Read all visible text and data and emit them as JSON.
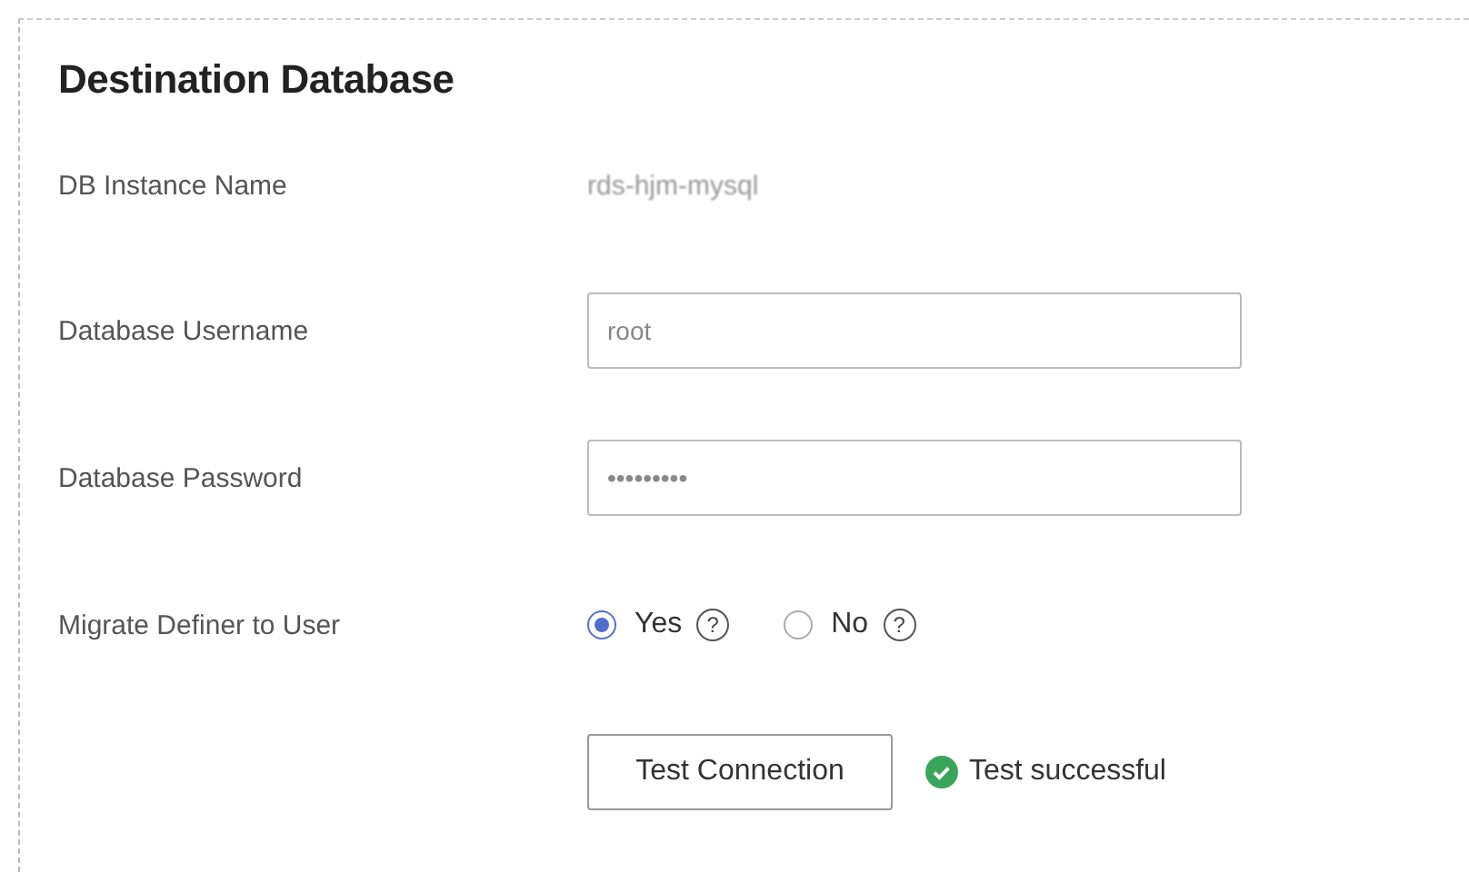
{
  "section": {
    "title": "Destination Database"
  },
  "fields": [
    {
      "kind": "text",
      "label": "DB Instance Name",
      "value": "rds-hjm-mysql"
    },
    {
      "kind": "input",
      "label": "Database Username",
      "value": "root"
    },
    {
      "kind": "input",
      "label": "Database Password",
      "value": "•••••••••"
    },
    {
      "kind": "radio",
      "label": "Migrate Definer to User",
      "options": [
        {
          "label": "Yes",
          "selected": true,
          "help": "?"
        },
        {
          "label": "No",
          "selected": false,
          "help": "?"
        }
      ]
    }
  ],
  "test": {
    "button": "Test Connection",
    "status": "Test successful",
    "success": true
  }
}
